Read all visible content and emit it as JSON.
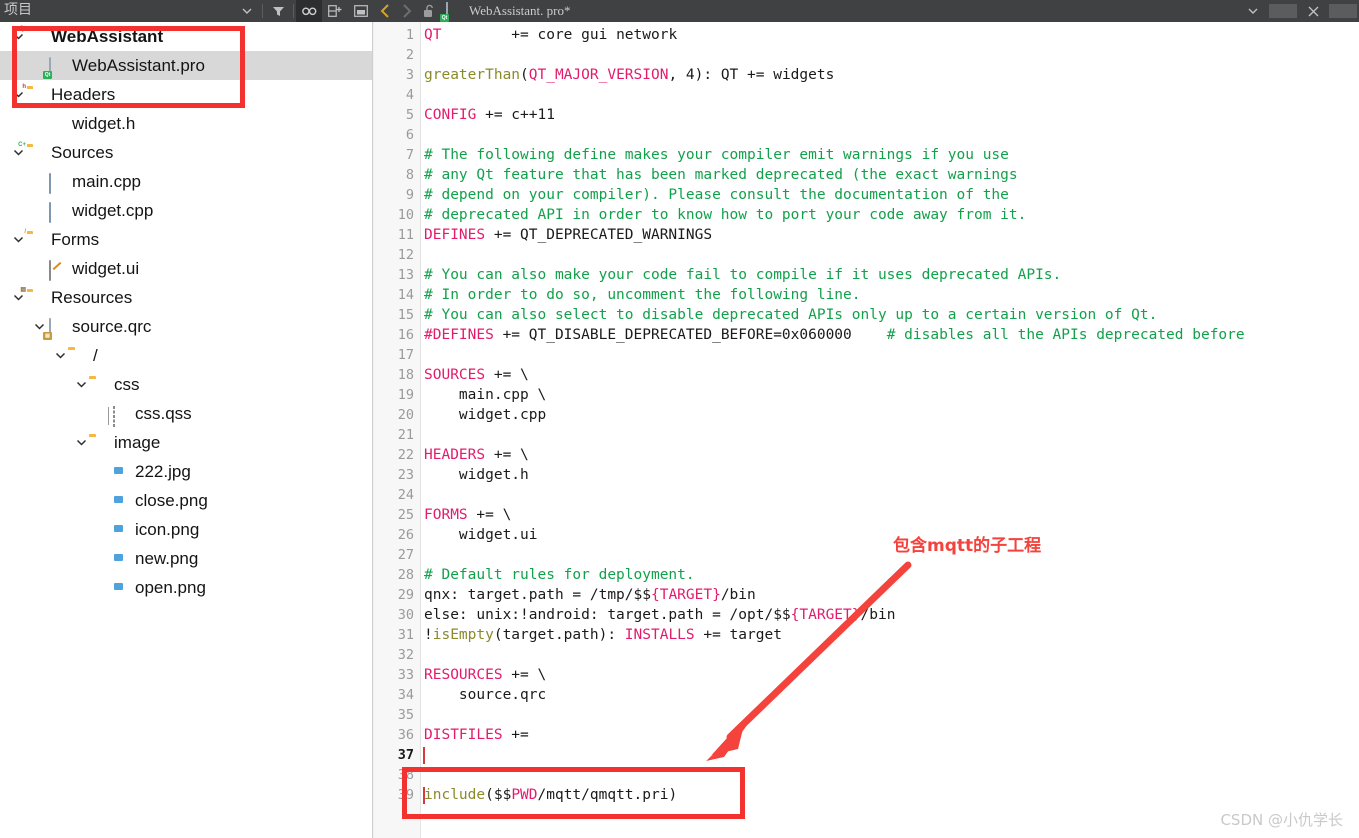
{
  "window": {
    "sidebar_title": "项目",
    "tab_title": "WebAssistant. pro*"
  },
  "toolbar": {
    "dropdown_label": "▾",
    "filter_label": "filter-icon",
    "link_label": "link-icon",
    "split_label": "split-icon",
    "dock_label": "dock-icon",
    "back_label": "‹",
    "forward_label": "›",
    "lock_label": "unlock-icon",
    "tab_dropdown_label": "▾",
    "close_label": "✕"
  },
  "tree": [
    {
      "label": "WebAssistant",
      "indent": 0,
      "arrow": "v",
      "icon": "folder-pro",
      "bold": true,
      "selected": false
    },
    {
      "label": "WebAssistant.pro",
      "indent": 1,
      "arrow": "",
      "icon": "doc-pro",
      "bold": false,
      "selected": true
    },
    {
      "label": "Headers",
      "indent": 0,
      "arrow": "v",
      "icon": "folder-h",
      "bold": false,
      "selected": false
    },
    {
      "label": "widget.h",
      "indent": 1,
      "arrow": "",
      "icon": "doc-h",
      "bold": false,
      "selected": false
    },
    {
      "label": "Sources",
      "indent": 0,
      "arrow": "v",
      "icon": "folder-cpp",
      "bold": false,
      "selected": false
    },
    {
      "label": "main.cpp",
      "indent": 1,
      "arrow": "",
      "icon": "doc-cpp",
      "bold": false,
      "selected": false
    },
    {
      "label": "widget.cpp",
      "indent": 1,
      "arrow": "",
      "icon": "doc-cpp",
      "bold": false,
      "selected": false
    },
    {
      "label": "Forms",
      "indent": 0,
      "arrow": "v",
      "icon": "folder-ui",
      "bold": false,
      "selected": false
    },
    {
      "label": "widget.ui",
      "indent": 1,
      "arrow": "",
      "icon": "doc-ui",
      "bold": false,
      "selected": false
    },
    {
      "label": "Resources",
      "indent": 0,
      "arrow": "v",
      "icon": "folder-qrc",
      "bold": false,
      "selected": false
    },
    {
      "label": "source.qrc",
      "indent": 1,
      "arrow": "v",
      "icon": "doc-qrc",
      "bold": false,
      "selected": false
    },
    {
      "label": "/",
      "indent": 2,
      "arrow": "v",
      "icon": "folder",
      "bold": false,
      "selected": false
    },
    {
      "label": "css",
      "indent": 3,
      "arrow": "v",
      "icon": "folder",
      "bold": false,
      "selected": false
    },
    {
      "label": "css.qss",
      "indent": 4,
      "arrow": "",
      "icon": "doc-qss",
      "bold": false,
      "selected": false
    },
    {
      "label": "image",
      "indent": 3,
      "arrow": "v",
      "icon": "folder",
      "bold": false,
      "selected": false
    },
    {
      "label": "222.jpg",
      "indent": 4,
      "arrow": "",
      "icon": "doc-img",
      "bold": false,
      "selected": false
    },
    {
      "label": "close.png",
      "indent": 4,
      "arrow": "",
      "icon": "doc-img",
      "bold": false,
      "selected": false
    },
    {
      "label": "icon.png",
      "indent": 4,
      "arrow": "",
      "icon": "doc-img",
      "bold": false,
      "selected": false
    },
    {
      "label": "new.png",
      "indent": 4,
      "arrow": "",
      "icon": "doc-img",
      "bold": false,
      "selected": false
    },
    {
      "label": "open.png",
      "indent": 4,
      "arrow": "",
      "icon": "doc-img",
      "bold": false,
      "selected": false
    }
  ],
  "editor": {
    "current_line": 37,
    "lines": [
      {
        "n": 1,
        "tokens": [
          [
            "var",
            "QT"
          ],
          [
            "txt",
            "        += core gui network"
          ]
        ]
      },
      {
        "n": 2,
        "tokens": []
      },
      {
        "n": 3,
        "tokens": [
          [
            "fn",
            "greaterThan"
          ],
          [
            "txt",
            "("
          ],
          [
            "var",
            "QT_MAJOR_VERSION"
          ],
          [
            "txt",
            ", 4): QT += widgets"
          ]
        ]
      },
      {
        "n": 4,
        "tokens": []
      },
      {
        "n": 5,
        "tokens": [
          [
            "var",
            "CONFIG"
          ],
          [
            "txt",
            " += c++11"
          ]
        ]
      },
      {
        "n": 6,
        "tokens": []
      },
      {
        "n": 7,
        "tokens": [
          [
            "cmt",
            "# The following define makes your compiler emit warnings if you use"
          ]
        ]
      },
      {
        "n": 8,
        "tokens": [
          [
            "cmt",
            "# any Qt feature that has been marked deprecated (the exact warnings"
          ]
        ]
      },
      {
        "n": 9,
        "tokens": [
          [
            "cmt",
            "# depend on your compiler). Please consult the documentation of the"
          ]
        ]
      },
      {
        "n": 10,
        "tokens": [
          [
            "cmt",
            "# deprecated API in order to know how to port your code away from it."
          ]
        ]
      },
      {
        "n": 11,
        "tokens": [
          [
            "var",
            "DEFINES"
          ],
          [
            "txt",
            " += QT_DEPRECATED_WARNINGS"
          ]
        ]
      },
      {
        "n": 12,
        "tokens": []
      },
      {
        "n": 13,
        "tokens": [
          [
            "cmt",
            "# You can also make your code fail to compile if it uses deprecated APIs."
          ]
        ]
      },
      {
        "n": 14,
        "tokens": [
          [
            "cmt",
            "# In order to do so, uncomment the following line."
          ]
        ]
      },
      {
        "n": 15,
        "tokens": [
          [
            "cmt",
            "# You can also select to disable deprecated APIs only up to a certain version of Qt."
          ]
        ]
      },
      {
        "n": 16,
        "tokens": [
          [
            "var",
            "#DEFINES"
          ],
          [
            "txt",
            " += QT_DISABLE_DEPRECATED_BEFORE=0x060000    "
          ],
          [
            "cmt",
            "# disables all the APIs deprecated before"
          ]
        ]
      },
      {
        "n": 17,
        "tokens": []
      },
      {
        "n": 18,
        "tokens": [
          [
            "var",
            "SOURCES"
          ],
          [
            "txt",
            " += \\"
          ]
        ]
      },
      {
        "n": 19,
        "tokens": [
          [
            "txt",
            "    main.cpp \\"
          ]
        ]
      },
      {
        "n": 20,
        "tokens": [
          [
            "txt",
            "    widget.cpp"
          ]
        ]
      },
      {
        "n": 21,
        "tokens": []
      },
      {
        "n": 22,
        "tokens": [
          [
            "var",
            "HEADERS"
          ],
          [
            "txt",
            " += \\"
          ]
        ]
      },
      {
        "n": 23,
        "tokens": [
          [
            "txt",
            "    widget.h"
          ]
        ]
      },
      {
        "n": 24,
        "tokens": []
      },
      {
        "n": 25,
        "tokens": [
          [
            "var",
            "FORMS"
          ],
          [
            "txt",
            " += \\"
          ]
        ]
      },
      {
        "n": 26,
        "tokens": [
          [
            "txt",
            "    widget.ui"
          ]
        ]
      },
      {
        "n": 27,
        "tokens": []
      },
      {
        "n": 28,
        "tokens": [
          [
            "cmt",
            "# Default rules for deployment."
          ]
        ]
      },
      {
        "n": 29,
        "tokens": [
          [
            "txt",
            "qnx: target.path = /tmp/$$"
          ],
          [
            "var",
            "{TARGET}"
          ],
          [
            "txt",
            "/bin"
          ]
        ]
      },
      {
        "n": 30,
        "tokens": [
          [
            "txt",
            "else: unix:!android: target.path = /opt/$$"
          ],
          [
            "var",
            "{TARGET}"
          ],
          [
            "txt",
            "/bin"
          ]
        ]
      },
      {
        "n": 31,
        "tokens": [
          [
            "txt",
            "!"
          ],
          [
            "fn",
            "isEmpty"
          ],
          [
            "txt",
            "(target.path): "
          ],
          [
            "var",
            "INSTALLS"
          ],
          [
            "txt",
            " += target"
          ]
        ]
      },
      {
        "n": 32,
        "tokens": []
      },
      {
        "n": 33,
        "tokens": [
          [
            "var",
            "RESOURCES"
          ],
          [
            "txt",
            " += \\"
          ]
        ]
      },
      {
        "n": 34,
        "tokens": [
          [
            "txt",
            "    source.qrc"
          ]
        ]
      },
      {
        "n": 35,
        "tokens": []
      },
      {
        "n": 36,
        "tokens": [
          [
            "var",
            "DISTFILES"
          ],
          [
            "txt",
            " +="
          ]
        ]
      },
      {
        "n": 37,
        "tokens": []
      },
      {
        "n": 38,
        "tokens": []
      },
      {
        "n": 39,
        "tokens": [
          [
            "fn",
            "include"
          ],
          [
            "txt",
            "($$"
          ],
          [
            "var",
            "PWD"
          ],
          [
            "txt",
            "/mqtt/qmqtt.pri)"
          ]
        ]
      }
    ]
  },
  "annotations": {
    "note_text": "包含mqtt的子工程",
    "accent_color": "#f3312f"
  },
  "watermark": {
    "text": "CSDN @小仇学长"
  }
}
